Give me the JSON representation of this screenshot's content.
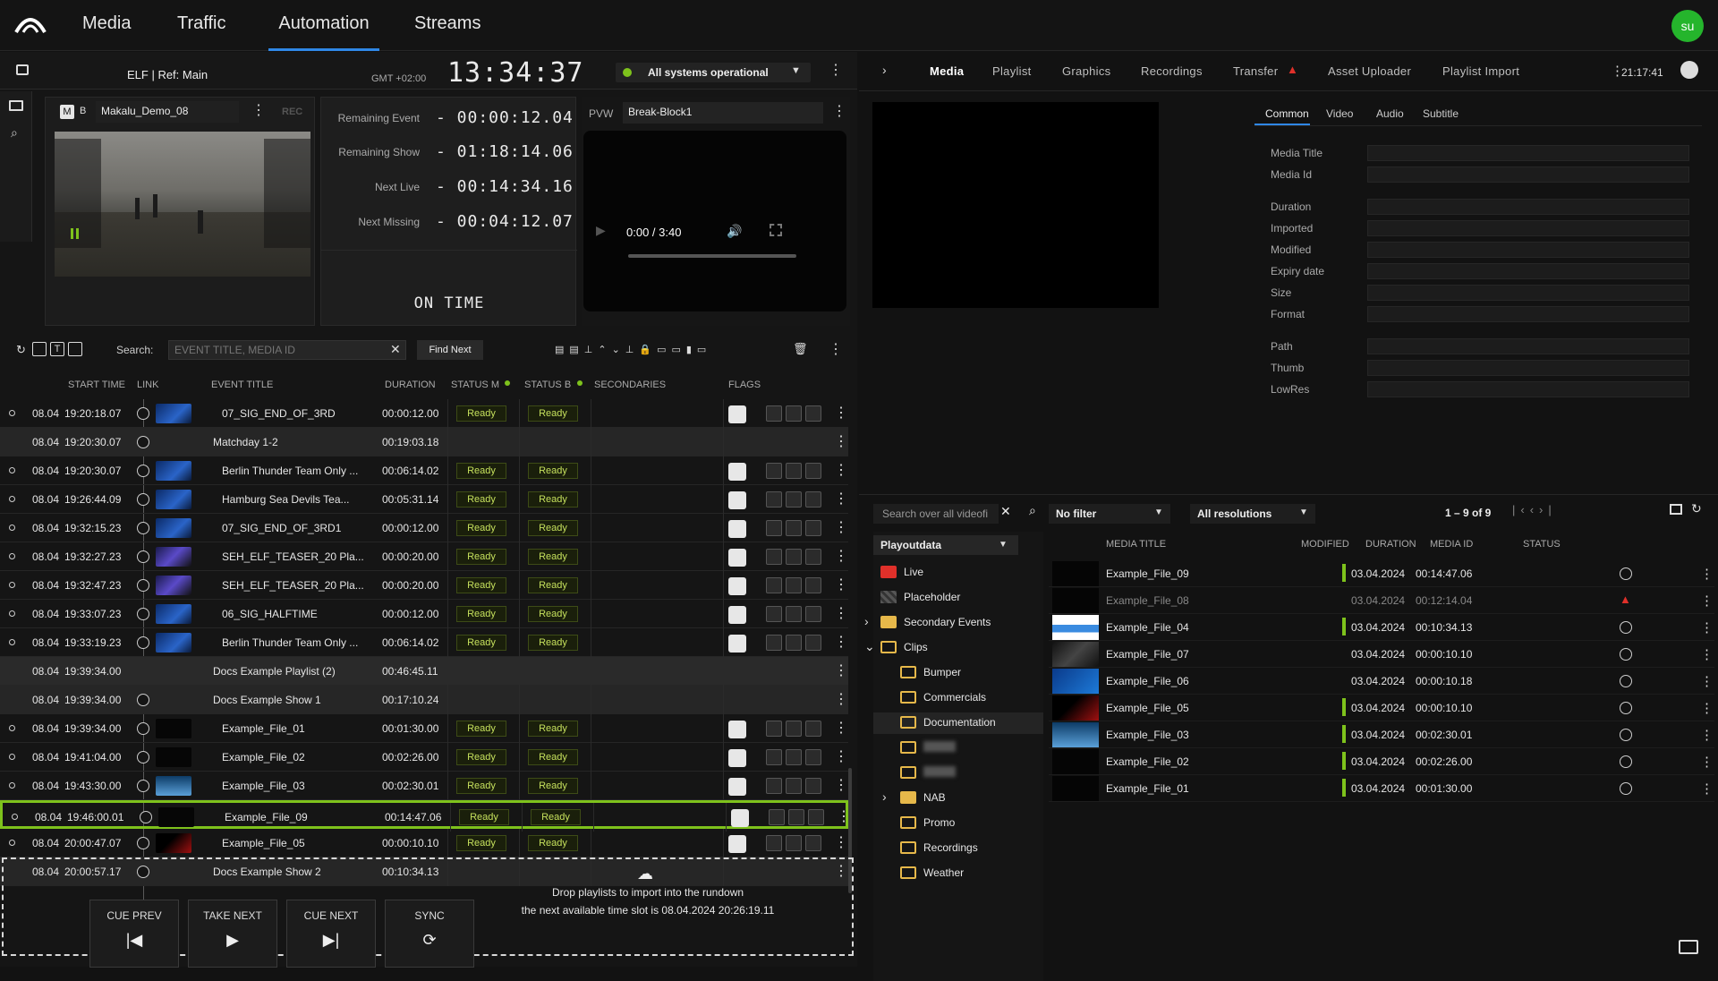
{
  "nav": {
    "tabs": [
      "Media",
      "Traffic",
      "Automation",
      "Streams"
    ],
    "active": "Automation",
    "avatar": "su"
  },
  "status": {
    "channel": "ELF | Ref: Main",
    "tz": "GMT +02:00",
    "clock": "13:34:37",
    "system_status": "All systems operational"
  },
  "preview": {
    "clip_badge_m": "M",
    "clip_badge_b": "B",
    "clip_name": "Makalu_Demo_08",
    "rec": "REC",
    "pvw_label": "PVW",
    "pvw_name": "Break-Block1",
    "player_time": "0:00 / 3:40"
  },
  "timers": [
    {
      "label": "Remaining Event",
      "value": "- 00:00:12.04"
    },
    {
      "label": "Remaining Show",
      "value": "- 01:18:14.06"
    },
    {
      "label": "Next Live",
      "value": "- 00:14:34.16"
    },
    {
      "label": "Next Missing",
      "value": "- 00:04:12.07"
    }
  ],
  "on_time": "ON TIME",
  "toolbar": {
    "search_label": "Search:",
    "search_placeholder": "EVENT TITLE, MEDIA ID",
    "find_next": "Find Next"
  },
  "columns": {
    "start": "START TIME",
    "link": "LINK",
    "title": "EVENT TITLE",
    "duration": "DURATION",
    "status_m": "STATUS M",
    "status_b": "STATUS B",
    "secondaries": "SECONDARIES",
    "flags": "FLAGS"
  },
  "rows": [
    {
      "date": "08.04",
      "time": "19:20:18.07",
      "title": "07_SIG_END_OF_3RD",
      "duration": "00:00:12.00",
      "sm": "Ready",
      "sb": "Ready",
      "type": "event",
      "thumb": "blue"
    },
    {
      "date": "08.04",
      "time": "19:20:30.07",
      "title": "Matchday 1-2",
      "duration": "00:19:03.18",
      "sm": "",
      "sb": "",
      "type": "group",
      "thumb": ""
    },
    {
      "date": "08.04",
      "time": "19:20:30.07",
      "title": "Berlin Thunder Team Only ...",
      "duration": "00:06:14.02",
      "sm": "Ready",
      "sb": "Ready",
      "type": "event",
      "thumb": "blue"
    },
    {
      "date": "08.04",
      "time": "19:26:44.09",
      "title": "Hamburg Sea Devils Tea...",
      "duration": "00:05:31.14",
      "sm": "Ready",
      "sb": "Ready",
      "type": "event",
      "thumb": "blue"
    },
    {
      "date": "08.04",
      "time": "19:32:15.23",
      "title": "07_SIG_END_OF_3RD1",
      "duration": "00:00:12.00",
      "sm": "Ready",
      "sb": "Ready",
      "type": "event",
      "thumb": "blue"
    },
    {
      "date": "08.04",
      "time": "19:32:27.23",
      "title": "SEH_ELF_TEASER_20 Pla...",
      "duration": "00:00:20.00",
      "sm": "Ready",
      "sb": "Ready",
      "type": "event",
      "thumb": "purple"
    },
    {
      "date": "08.04",
      "time": "19:32:47.23",
      "title": "SEH_ELF_TEASER_20 Pla...",
      "duration": "00:00:20.00",
      "sm": "Ready",
      "sb": "Ready",
      "type": "event",
      "thumb": "purple"
    },
    {
      "date": "08.04",
      "time": "19:33:07.23",
      "title": "06_SIG_HALFTIME",
      "duration": "00:00:12.00",
      "sm": "Ready",
      "sb": "Ready",
      "type": "event",
      "thumb": "blue"
    },
    {
      "date": "08.04",
      "time": "19:33:19.23",
      "title": "Berlin Thunder Team Only ...",
      "duration": "00:06:14.02",
      "sm": "Ready",
      "sb": "Ready",
      "type": "event",
      "thumb": "blue"
    },
    {
      "date": "08.04",
      "time": "19:39:34.00",
      "title": "Docs Example Playlist (2)",
      "duration": "00:46:45.11",
      "sm": "",
      "sb": "",
      "type": "playlist",
      "thumb": ""
    },
    {
      "date": "08.04",
      "time": "19:39:34.00",
      "title": "Docs Example Show 1",
      "duration": "00:17:10.24",
      "sm": "",
      "sb": "",
      "type": "group",
      "thumb": ""
    },
    {
      "date": "08.04",
      "time": "19:39:34.00",
      "title": "Example_File_01",
      "duration": "00:01:30.00",
      "sm": "Ready",
      "sb": "Ready",
      "type": "event",
      "thumb": "black"
    },
    {
      "date": "08.04",
      "time": "19:41:04.00",
      "title": "Example_File_02",
      "duration": "00:02:26.00",
      "sm": "Ready",
      "sb": "Ready",
      "type": "event",
      "thumb": "black"
    },
    {
      "date": "08.04",
      "time": "19:43:30.00",
      "title": "Example_File_03",
      "duration": "00:02:30.01",
      "sm": "Ready",
      "sb": "Ready",
      "type": "event",
      "thumb": "sky"
    },
    {
      "date": "08.04",
      "time": "19:46:00.01",
      "title": "Example_File_09",
      "duration": "00:14:47.06",
      "sm": "Ready",
      "sb": "Ready",
      "type": "event",
      "thumb": "black",
      "selected": true
    },
    {
      "date": "08.04",
      "time": "20:00:47.07",
      "title": "Example_File_05",
      "duration": "00:00:10.10",
      "sm": "Ready",
      "sb": "Ready",
      "type": "event",
      "thumb": "red"
    },
    {
      "date": "08.04",
      "time": "20:00:57.17",
      "title": "Docs Example Show 2",
      "duration": "00:10:34.13",
      "sm": "",
      "sb": "",
      "type": "group",
      "thumb": ""
    }
  ],
  "drop": {
    "line1": "Drop playlists to import into the rundown",
    "line2": "the next available time slot is 08.04.2024 20:26:19.11"
  },
  "controls": [
    {
      "label": "CUE PREV",
      "glyph": "|◀"
    },
    {
      "label": "TAKE NEXT",
      "glyph": "▶"
    },
    {
      "label": "CUE NEXT",
      "glyph": "▶|"
    },
    {
      "label": "SYNC",
      "glyph": "⟳"
    }
  ],
  "right": {
    "tabs": [
      "Media",
      "Playlist",
      "Graphics",
      "Recordings",
      "Transfer",
      "Asset Uploader",
      "Playlist Import"
    ],
    "active": "Media",
    "time": "21:17:41",
    "meta_tabs": [
      "Common",
      "Video",
      "Audio",
      "Subtitle"
    ],
    "meta_labels": [
      "Media Title",
      "Media Id",
      "Duration",
      "Imported",
      "Modified",
      "Expiry date",
      "Size",
      "Format",
      "Path",
      "Thumb",
      "LowRes"
    ],
    "search_placeholder": "Search over all videofi",
    "filter": "No filter",
    "resolution": "All resolutions",
    "pager": "1 – 9 of 9",
    "source": "Playoutdata",
    "tree": [
      {
        "label": "Live",
        "kind": "live",
        "indent": 0,
        "expander": ""
      },
      {
        "label": "Placeholder",
        "kind": "placeholder",
        "indent": 0,
        "expander": ""
      },
      {
        "label": "Secondary Events",
        "kind": "folder-fill",
        "indent": 0,
        "expander": "›"
      },
      {
        "label": "Clips",
        "kind": "folder",
        "indent": 0,
        "expander": "⌄"
      },
      {
        "label": "Bumper",
        "kind": "folder",
        "indent": 1,
        "expander": ""
      },
      {
        "label": "Commercials",
        "kind": "folder",
        "indent": 1,
        "expander": ""
      },
      {
        "label": "Documentation",
        "kind": "folder",
        "indent": 1,
        "expander": "",
        "selected": true
      },
      {
        "label": "",
        "kind": "folder",
        "indent": 1,
        "expander": "",
        "blurred": true
      },
      {
        "label": "",
        "kind": "folder",
        "indent": 1,
        "expander": "",
        "blurred": true
      },
      {
        "label": "NAB",
        "kind": "folder-fill",
        "indent": 1,
        "expander": "›"
      },
      {
        "label": "Promo",
        "kind": "folder",
        "indent": 1,
        "expander": ""
      },
      {
        "label": "Recordings",
        "kind": "folder",
        "indent": 1,
        "expander": ""
      },
      {
        "label": "Weather",
        "kind": "folder",
        "indent": 1,
        "expander": ""
      }
    ],
    "media_columns": {
      "title": "MEDIA TITLE",
      "modified": "MODIFIED",
      "duration": "DURATION",
      "id": "MEDIA ID",
      "status": "STATUS"
    },
    "media": [
      {
        "title": "Example_File_09",
        "modified": "03.04.2024",
        "duration": "00:14:47.06",
        "status": "ok",
        "thumb": "black",
        "bar": true
      },
      {
        "title": "Example_File_08",
        "modified": "03.04.2024",
        "duration": "00:12:14.04",
        "status": "warn",
        "thumb": "black",
        "bar": false,
        "dim": true
      },
      {
        "title": "Example_File_04",
        "modified": "03.04.2024",
        "duration": "00:10:34.13",
        "status": "ok",
        "thumb": "bunny",
        "bar": true
      },
      {
        "title": "Example_File_07",
        "modified": "03.04.2024",
        "duration": "00:00:10.10",
        "status": "ok",
        "thumb": "dark",
        "bar": false
      },
      {
        "title": "Example_File_06",
        "modified": "03.04.2024",
        "duration": "00:00:10.18",
        "status": "ok",
        "thumb": "blue",
        "bar": false
      },
      {
        "title": "Example_File_05",
        "modified": "03.04.2024",
        "duration": "00:00:10.10",
        "status": "ok",
        "thumb": "red",
        "bar": true
      },
      {
        "title": "Example_File_03",
        "modified": "03.04.2024",
        "duration": "00:02:30.01",
        "status": "ok",
        "thumb": "sky",
        "bar": true
      },
      {
        "title": "Example_File_02",
        "modified": "03.04.2024",
        "duration": "00:02:26.00",
        "status": "ok",
        "thumb": "black",
        "bar": true
      },
      {
        "title": "Example_File_01",
        "modified": "03.04.2024",
        "duration": "00:01:30.00",
        "status": "ok",
        "thumb": "black",
        "bar": true
      }
    ]
  },
  "colors": {
    "accent": "#2f87e6",
    "ready": "#c5e05c",
    "selected": "#7ec21c",
    "warn": "#e0302a",
    "avatar": "#25b52c"
  }
}
